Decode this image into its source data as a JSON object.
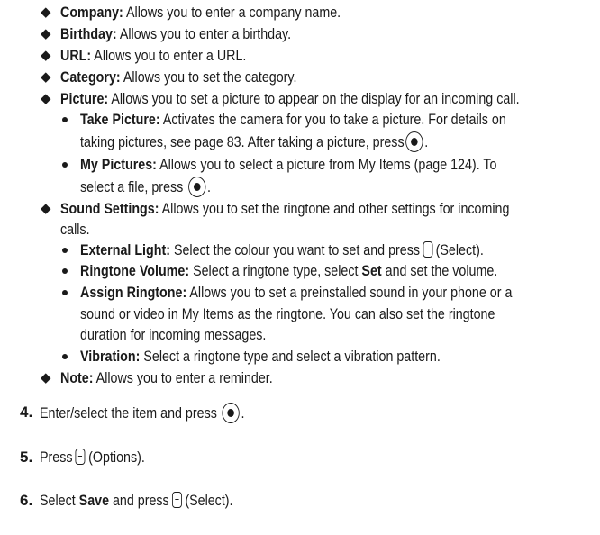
{
  "items": {
    "company": {
      "label": "Company:",
      "text": " Allows you to enter a company name."
    },
    "birthday": {
      "label": "Birthday:",
      "text": " Allows you to enter a birthday."
    },
    "url": {
      "label": "URL:",
      "text": " Allows you to enter a URL."
    },
    "category": {
      "label": "Category:",
      "text": " Allows you to set the category."
    },
    "picture": {
      "label": "Picture:",
      "text": " Allows you to set a picture to appear on the display for an incoming call."
    },
    "take_picture": {
      "label": "Take Picture:",
      "text1": " Activates the camera for you to take a picture. For details on",
      "text2": "taking pictures, see page 83. After taking a picture, press",
      "end": "."
    },
    "my_pictures": {
      "label": "My Pictures:",
      "text1": " Allows you to select a picture from My Items (page 124). To",
      "text2": "select a file, press",
      "end": "."
    },
    "sound_settings": {
      "label": "Sound Settings:",
      "text1": " Allows you to set the ringtone and other settings for incoming",
      "text2": "calls."
    },
    "external_light": {
      "label": "External Light:",
      "text": " Select the colour you want to set and press",
      "end": "(Select)."
    },
    "ringtone_volume": {
      "label": "Ringtone Volume:",
      "text": " Select a ringtone type, select ",
      "bold": "Set",
      "end": " and set the volume."
    },
    "assign_ringtone": {
      "label": "Assign Ringtone:",
      "text1": " Allows you to set a preinstalled sound in your phone or a",
      "text2": "sound or video in My Items as the ringtone. You can also set the ringtone",
      "text3": "duration for incoming messages."
    },
    "vibration": {
      "label": "Vibration:",
      "text": " Select a ringtone type and select a vibration pattern."
    },
    "note": {
      "label": "Note:",
      "text": " Allows you to enter a reminder."
    }
  },
  "steps": [
    {
      "num": "4.",
      "text": "Enter/select the item and press",
      "end": "."
    },
    {
      "num": "5.",
      "text": "Press",
      "end": "(Options)."
    },
    {
      "num": "6.",
      "pre": "Select ",
      "bold": "Save",
      "text": " and press",
      "end": "(Select)."
    }
  ]
}
